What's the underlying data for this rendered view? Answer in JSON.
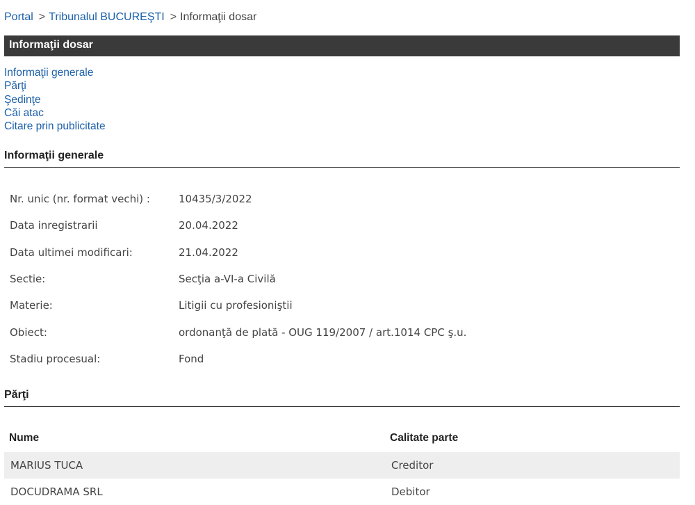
{
  "breadcrumb": {
    "items": [
      "Portal",
      "Tribunalul BUCUREŞTI"
    ],
    "separator": ">",
    "current": "Informaţii dosar"
  },
  "title": "Informaţii dosar",
  "nav_links": [
    "Informaţii generale",
    "Părţi",
    "Şedinţe",
    "Căi atac",
    "Citare prin publicitate"
  ],
  "general_info": {
    "heading": "Informaţii generale",
    "rows": [
      {
        "label": "Nr. unic (nr. format vechi) :",
        "value": "10435/3/2022"
      },
      {
        "label": "Data inregistrarii",
        "value": "20.04.2022"
      },
      {
        "label": "Data ultimei modificari:",
        "value": "21.04.2022"
      },
      {
        "label": "Sectie:",
        "value": "Secţia a-VI-a Civilă"
      },
      {
        "label": "Materie:",
        "value": "Litigii cu profesioniştii"
      },
      {
        "label": "Obiect:",
        "value": "ordonanţă de plată - OUG 119/2007 / art.1014 CPC ş.u."
      },
      {
        "label": "Stadiu procesual:",
        "value": "Fond"
      }
    ]
  },
  "parties": {
    "heading": "Părţi",
    "columns": [
      "Nume",
      "Calitate parte"
    ],
    "rows": [
      {
        "name": "MARIUS TUCA",
        "role": "Creditor"
      },
      {
        "name": "DOCUDRAMA SRL",
        "role": "Debitor"
      }
    ]
  },
  "colors": {
    "link": "#1a5fa8",
    "title_bar": "#3a3a3a",
    "row_shade": "#eeeeee"
  }
}
